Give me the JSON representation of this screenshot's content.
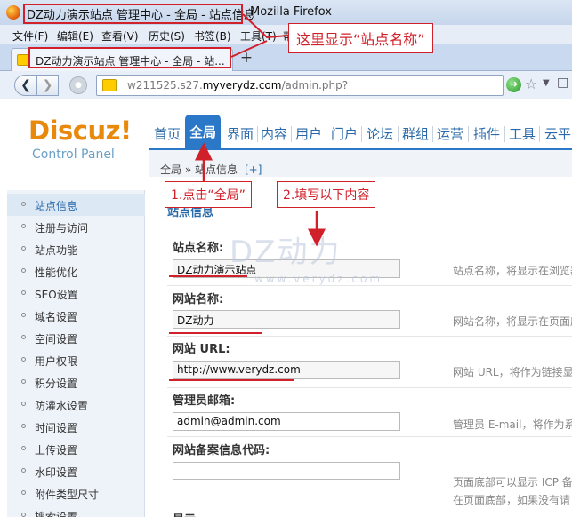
{
  "browser": {
    "window_title": "DZ动力演示站点 管理中心 - 全局 - 站点信息",
    "app_name": "Mozilla Firefox",
    "menu": [
      "文件(F)",
      "编辑(E)",
      "查看(V)",
      "历史(S)",
      "书签(B)",
      "工具(T)",
      "帮"
    ],
    "tab_title": "DZ动力演示站点 管理中心 - 全局 - 站...",
    "new_tab": "+",
    "url_prefix": "w211525.s27.",
    "url_domain": "myverydz.com",
    "url_path": "/admin.php?"
  },
  "app": {
    "logo": "Discuz!",
    "logo_sub": "Control Panel",
    "nav": [
      "首页",
      "全局",
      "界面",
      "内容",
      "用户",
      "门户",
      "论坛",
      "群组",
      "运营",
      "插件",
      "工具",
      "云平"
    ],
    "active_nav": "全局",
    "breadcrumb": "全局 » 站点信息",
    "breadcrumb_add": "[+]"
  },
  "sidebar": {
    "items": [
      "站点信息",
      "注册与访问",
      "站点功能",
      "性能优化",
      "SEO设置",
      "域名设置",
      "空间设置",
      "用户权限",
      "积分设置",
      "防灌水设置",
      "时间设置",
      "上传设置",
      "水印设置",
      "附件类型尺寸",
      "搜索设置"
    ]
  },
  "form": {
    "section_title": "站点信息",
    "fields": [
      {
        "label": "站点名称:",
        "value": "DZ动力演示站点",
        "hint": "站点名称，将显示在浏览器"
      },
      {
        "label": "网站名称:",
        "value": "DZ动力",
        "hint": "网站名称，将显示在页面底"
      },
      {
        "label": "网站 URL:",
        "value": "http://www.verydz.com",
        "hint": "网站 URL，将作为链接显"
      },
      {
        "label": "管理员邮箱:",
        "value": "admin@admin.com",
        "hint": "管理员 E-mail，将作为系"
      },
      {
        "label": "网站备案信息代码:",
        "value": "",
        "hint": "页面底部可以显示 ICP 备"
      }
    ],
    "hint_extra": "在页面底部，如果没有请",
    "next_label": "显示"
  },
  "watermark": {
    "text": "DZ动力",
    "sub": "www.verydz.com"
  },
  "annotations": {
    "title_note": "这里显示“站点名称”",
    "step1": "1.点击“全局”",
    "step2": "2.填写以下内容"
  },
  "colors": {
    "annotation": "#d0202a",
    "accent": "#2b78c8",
    "logo": "#e8890c"
  }
}
